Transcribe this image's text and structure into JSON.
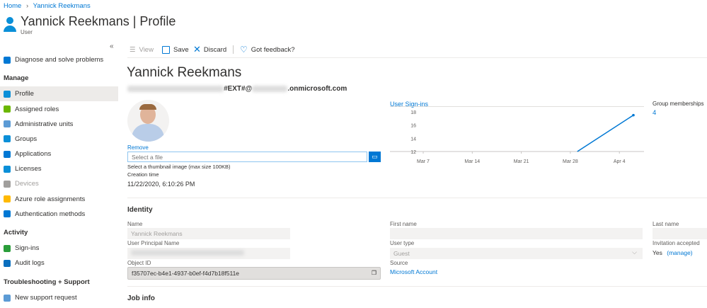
{
  "breadcrumb": [
    "Home",
    "Yannick Reekmans"
  ],
  "header": {
    "title": "Yannick Reekmans | Profile",
    "subtitle": "User",
    "more": "···"
  },
  "sidebar": {
    "collapse": "«",
    "top_item": {
      "label": "Diagnose and solve problems",
      "icon": "wrench-icon"
    },
    "sections": [
      {
        "title": "Manage",
        "items": [
          {
            "label": "Profile",
            "icon": "user-icon",
            "selected": true
          },
          {
            "label": "Assigned roles",
            "icon": "roles-icon"
          },
          {
            "label": "Administrative units",
            "icon": "admin-units-icon"
          },
          {
            "label": "Groups",
            "icon": "groups-icon"
          },
          {
            "label": "Applications",
            "icon": "apps-grid-icon"
          },
          {
            "label": "Licenses",
            "icon": "license-icon"
          },
          {
            "label": "Devices",
            "icon": "device-icon",
            "disabled": true
          },
          {
            "label": "Azure role assignments",
            "icon": "key-icon"
          },
          {
            "label": "Authentication methods",
            "icon": "shield-icon"
          }
        ]
      },
      {
        "title": "Activity",
        "items": [
          {
            "label": "Sign-ins",
            "icon": "signin-icon"
          },
          {
            "label": "Audit logs",
            "icon": "audit-icon"
          }
        ]
      },
      {
        "title": "Troubleshooting + Support",
        "items": [
          {
            "label": "New support request",
            "icon": "support-icon"
          }
        ]
      }
    ]
  },
  "toolbar": {
    "view": "View",
    "save": "Save",
    "discard": "Discard",
    "feedback": "Got feedback?"
  },
  "profile": {
    "name": "Yannick Reekmans",
    "email_mid": "#EXT#@",
    "email_end": ".onmicrosoft.com",
    "remove": "Remove",
    "file_placeholder": "Select a file",
    "file_hint": "Select a thumbnail image (max size 100KB)",
    "creation_label": "Creation time",
    "creation_value": "11/22/2020, 6:10:26 PM",
    "group_label": "Group memberships",
    "group_value": "4"
  },
  "chart_data": {
    "type": "line",
    "title": "User Sign-ins",
    "x_ticks": [
      "Mar 7",
      "Mar 14",
      "Mar 21",
      "Mar 28",
      "Apr 4"
    ],
    "y_ticks": [
      12,
      14,
      16,
      18
    ],
    "ylim": [
      12,
      18
    ],
    "x": [
      "Mar 29",
      "Apr 6"
    ],
    "values": [
      12,
      17.5
    ],
    "color": "#0078d4"
  },
  "identity": {
    "title": "Identity",
    "name_label": "Name",
    "name_value": "Yannick Reekmans",
    "first_label": "First name",
    "last_label": "Last name",
    "upn_label": "User Principal Name",
    "usertype_label": "User type",
    "usertype_value": "Guest",
    "inv_label": "Invitation accepted",
    "inv_value": "Yes",
    "inv_manage": "(manage)",
    "objid_label": "Object ID",
    "objid_value": "f35707ec-b4e1-4937-b0ef-f4d7b18f511e",
    "source_label": "Source",
    "source_value": "Microsoft Account"
  },
  "jobinfo": {
    "title": "Job info"
  }
}
